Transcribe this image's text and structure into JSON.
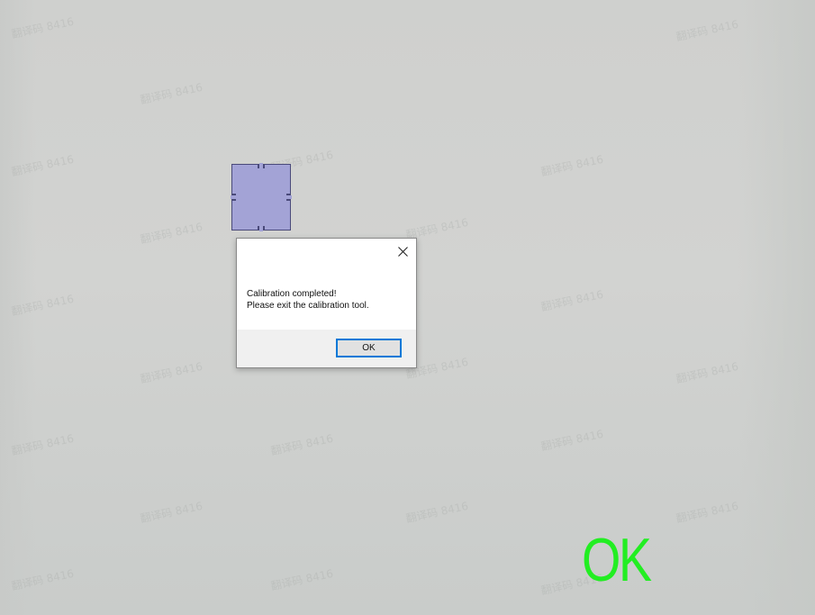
{
  "calibration": {
    "target_color": "#a3a3d6",
    "target_border_color": "#4a4a7a",
    "status_text": "OK",
    "status_color": "#22ee22"
  },
  "watermarks": {
    "text": "8416"
  },
  "dialog": {
    "close_icon": "close-icon",
    "message_line1": "Calibration completed!",
    "message_line2": "Please exit the calibration tool.",
    "ok_label": "OK",
    "accent_color": "#0078d7"
  }
}
